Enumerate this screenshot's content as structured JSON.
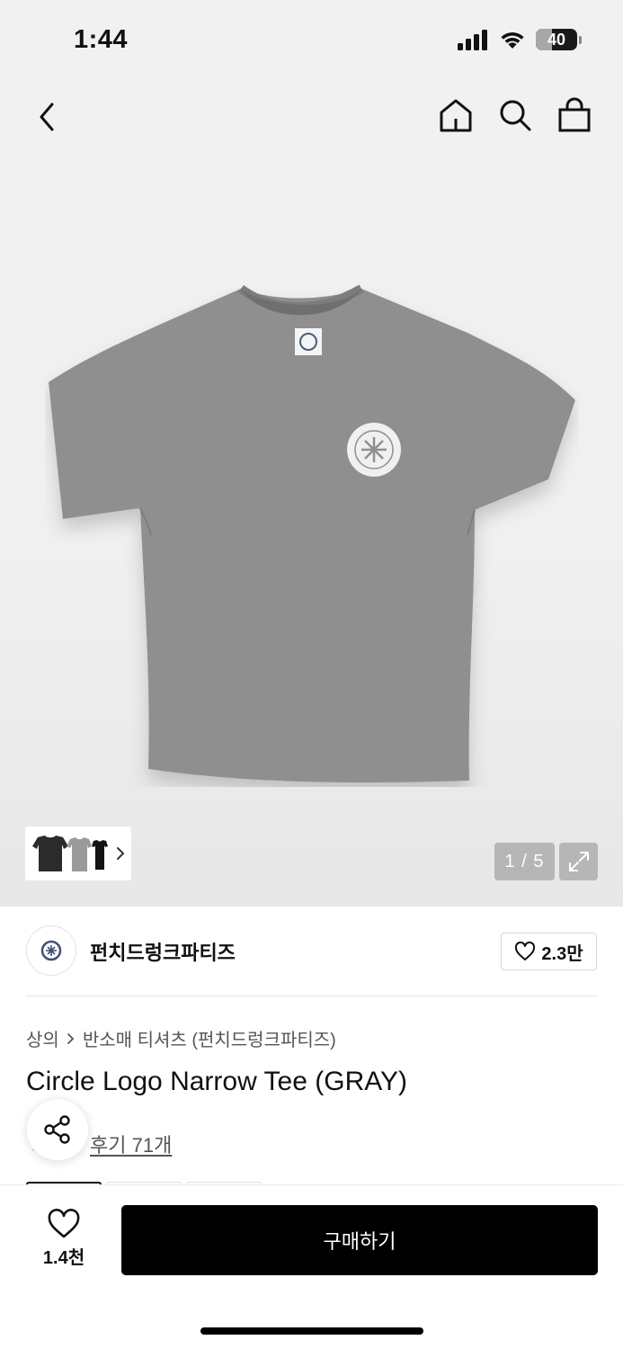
{
  "status_bar": {
    "time": "1:44",
    "battery": "40"
  },
  "nav": {
    "back_icon": "chevron-left-icon",
    "icons": [
      "home-icon",
      "search-icon",
      "shopping-bag-icon"
    ]
  },
  "hero": {
    "page_indicator": "1 / 5",
    "colors": [
      "#2b2b2b",
      "#9a9a9a",
      "#141414"
    ]
  },
  "brand": {
    "name": "펀치드렁크파티즈",
    "likes": "2.3만"
  },
  "breadcrumb": {
    "category": "상의",
    "subcategory": "반소매 티셔츠 (펀치드렁크파티즈)"
  },
  "product": {
    "title": "Circle Logo Narrow Tee (GRAY)",
    "reviews": "후기 71개"
  },
  "bottom_bar": {
    "wishlist_count": "1.4천",
    "buy_label": "구매하기"
  },
  "colors": {
    "accent": "#000000",
    "hero_bg": "#f0f0f0",
    "shirt": "#8f8f8f"
  }
}
